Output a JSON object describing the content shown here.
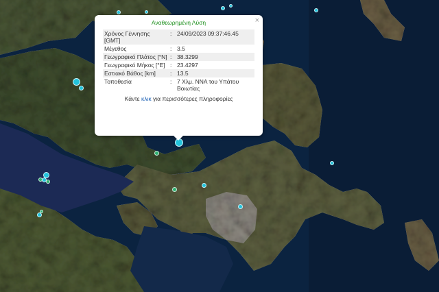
{
  "popup": {
    "title": "Αναθεωρημένη Λύση",
    "close_label": "×",
    "rows": [
      {
        "label": "Χρόνος Γέννησης [GMT]",
        "sep": ":",
        "value": "24/09/2023 09:37:46.45"
      },
      {
        "label": "Μέγεθος",
        "sep": ":",
        "value": "3.5"
      },
      {
        "label": "Γεωγραφικό Πλάτος [°N]",
        "sep": ":",
        "value": "38.3299"
      },
      {
        "label": "Γεωγραφικό Μήκος [°E]",
        "sep": ":",
        "value": "23.4297"
      },
      {
        "label": "Εστιακό Βάθος [km]",
        "sep": ":",
        "value": "13.5"
      },
      {
        "label": "Τοποθεσία",
        "sep": ":",
        "value": "7 Χλμ. ΝΝΑ του Υπάτου Βοιωτίας"
      }
    ],
    "more_prefix": "Κάντε",
    "more_link": "κλικ",
    "more_suffix": "για περισσότερες πληροφορίες"
  },
  "colors": {
    "sea": "#0b2340",
    "sea_deep": "#0a1d36",
    "gulf": "#1c2a55",
    "land": "#4a5636",
    "land_dark": "#36452a",
    "land_light": "#7d6e52",
    "urban": "#8e8a82",
    "marker_cyan": "#22c3dc",
    "marker_green": "#2fb070"
  },
  "markers": {
    "selected_color": "cyan",
    "count": 20
  }
}
